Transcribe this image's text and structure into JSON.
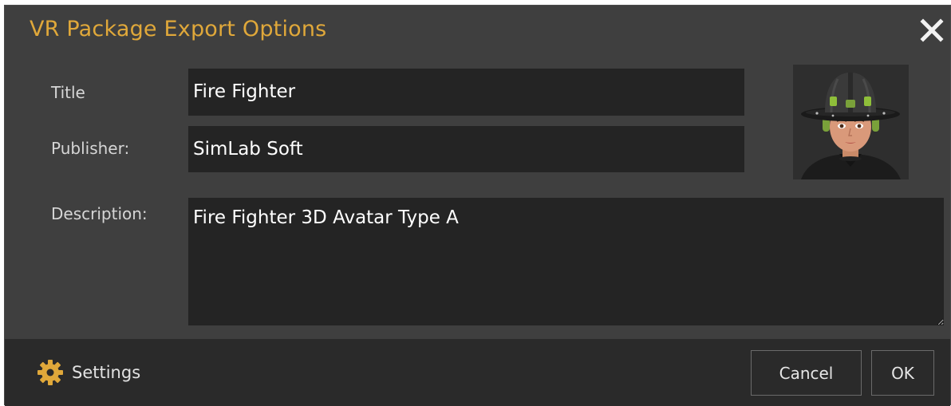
{
  "dialog": {
    "title": "VR Package Export Options",
    "accent_color": "#e0a83a",
    "close_icon": "close-icon"
  },
  "form": {
    "title_label": "Title",
    "title_value": "Fire Fighter",
    "publisher_label": "Publisher:",
    "publisher_value": "SimLab Soft",
    "description_label": "Description:",
    "description_value": "Fire Fighter 3D Avatar Type A"
  },
  "preview": {
    "image": "firefighter-avatar-thumbnail"
  },
  "footer": {
    "settings_label": "Settings",
    "settings_icon": "gear-icon",
    "cancel_label": "Cancel",
    "ok_label": "OK"
  }
}
